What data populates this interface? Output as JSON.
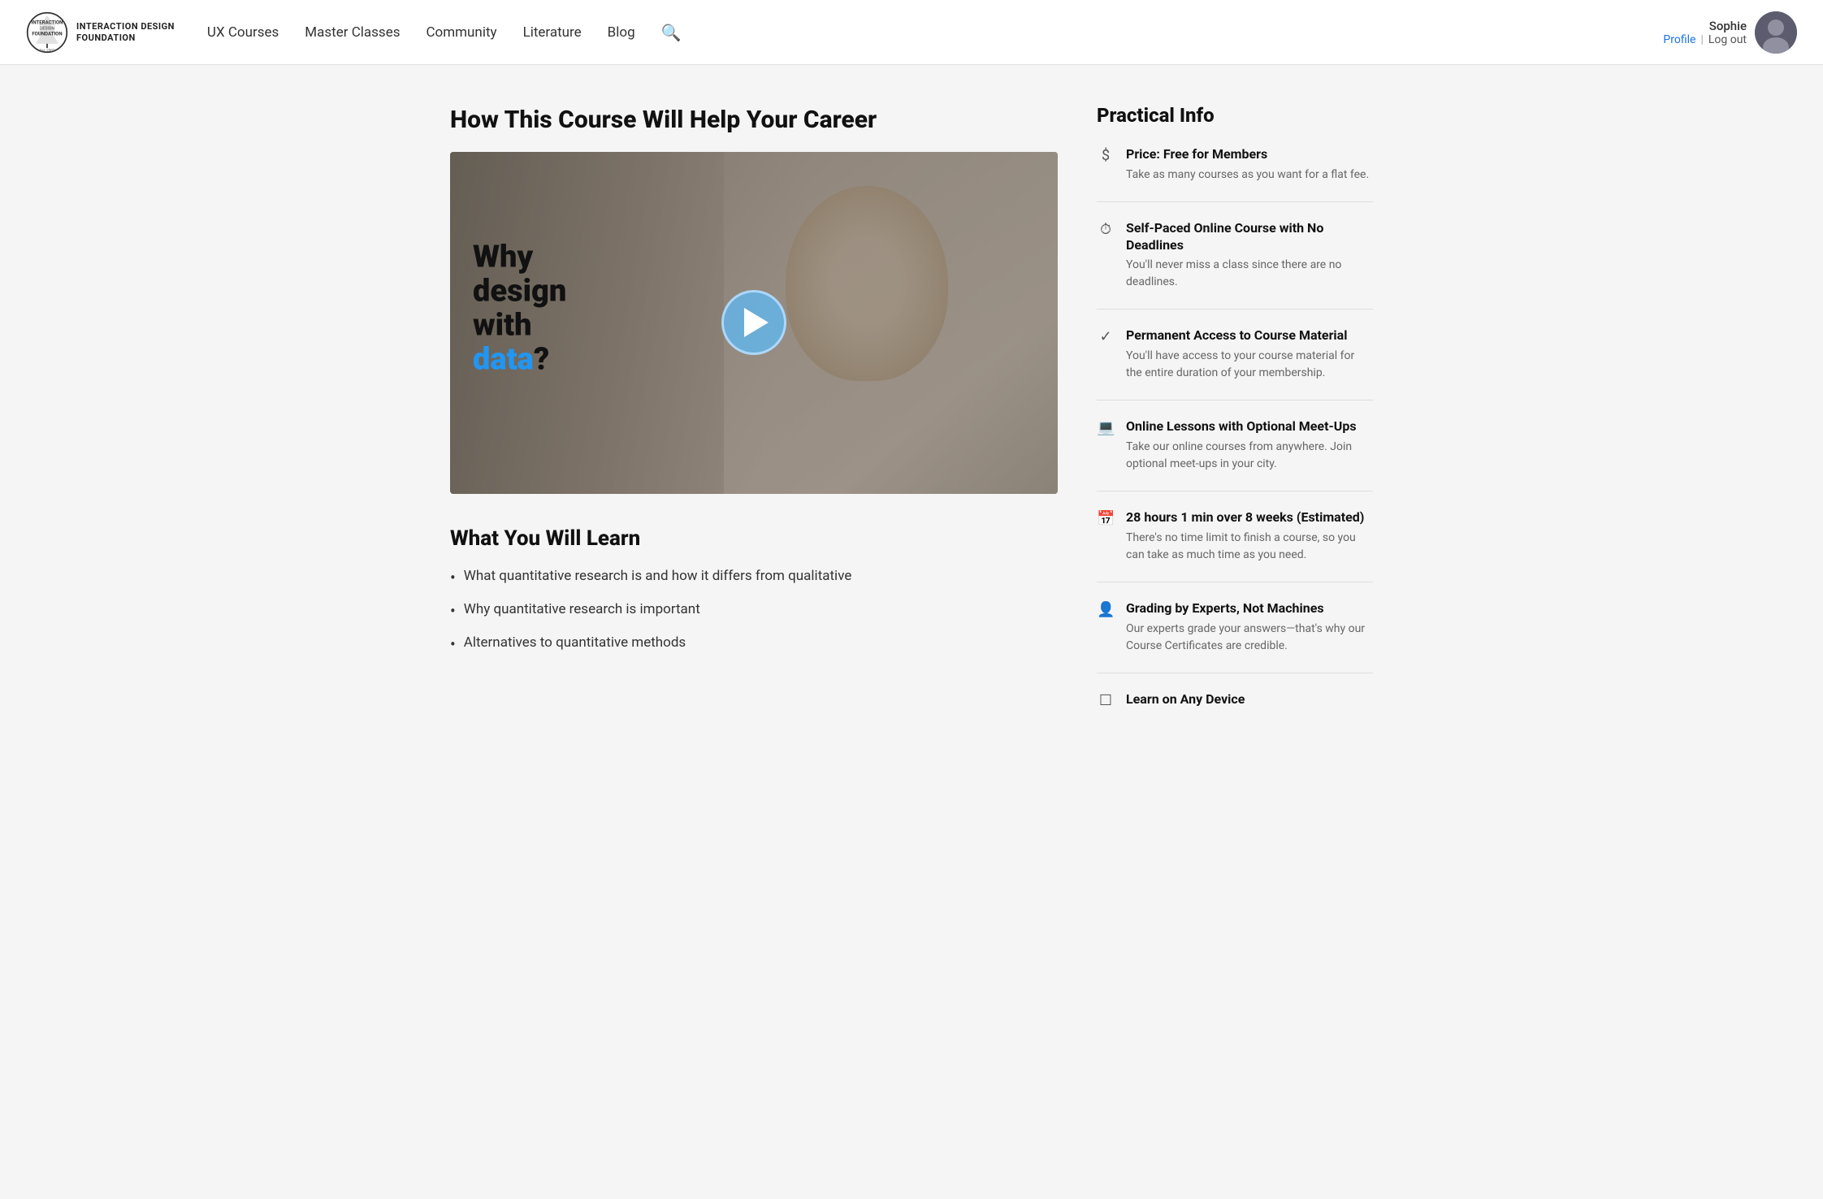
{
  "header": {
    "logo_name": "INTERACTION DESIGN",
    "logo_sub": "FOUNDATION",
    "logo_est": "Est. 2002",
    "nav_items": [
      {
        "label": "UX Courses",
        "id": "ux-courses"
      },
      {
        "label": "Master Classes",
        "id": "master-classes"
      },
      {
        "label": "Community",
        "id": "community"
      },
      {
        "label": "Literature",
        "id": "literature"
      },
      {
        "label": "Blog",
        "id": "blog"
      }
    ],
    "user_name": "Sophie",
    "profile_label": "Profile",
    "separator": "|",
    "logout_label": "Log out"
  },
  "main": {
    "page_title": "How This Course Will Help Your Career",
    "video": {
      "text_line1": "Why",
      "text_line2": "design",
      "text_line3": "with",
      "text_highlight": "data",
      "text_end": "?"
    },
    "learn_section_title": "What You Will Learn",
    "learn_items": [
      "What quantitative research is and how it differs from qualitative",
      "Why quantitative research is important",
      "Alternatives to quantitative methods"
    ]
  },
  "practical": {
    "title": "Practical Info",
    "items": [
      {
        "icon": "$",
        "label": "Price: Free for Members",
        "desc": "Take as many courses as you want for a flat fee."
      },
      {
        "icon": "⏱",
        "label": "Self-Paced Online Course with No Deadlines",
        "desc": "You'll never miss a class since there are no deadlines."
      },
      {
        "icon": "✓",
        "label": "Permanent Access to Course Material",
        "desc": "You'll have access to your course material for the entire duration of your membership."
      },
      {
        "icon": "💻",
        "label": "Online Lessons with Optional Meet-Ups",
        "desc": "Take our online courses from anywhere. Join optional meet-ups in your city."
      },
      {
        "icon": "📅",
        "label": "28 hours 1 min over 8 weeks (Estimated)",
        "desc": "There's no time limit to finish a course, so you can take as much time as you need."
      },
      {
        "icon": "👤",
        "label": "Grading by Experts, Not Machines",
        "desc": "Our experts grade your answers—that's why our Course Certificates are credible."
      },
      {
        "icon": "☐",
        "label": "Learn on Any Device",
        "desc": ""
      }
    ]
  }
}
